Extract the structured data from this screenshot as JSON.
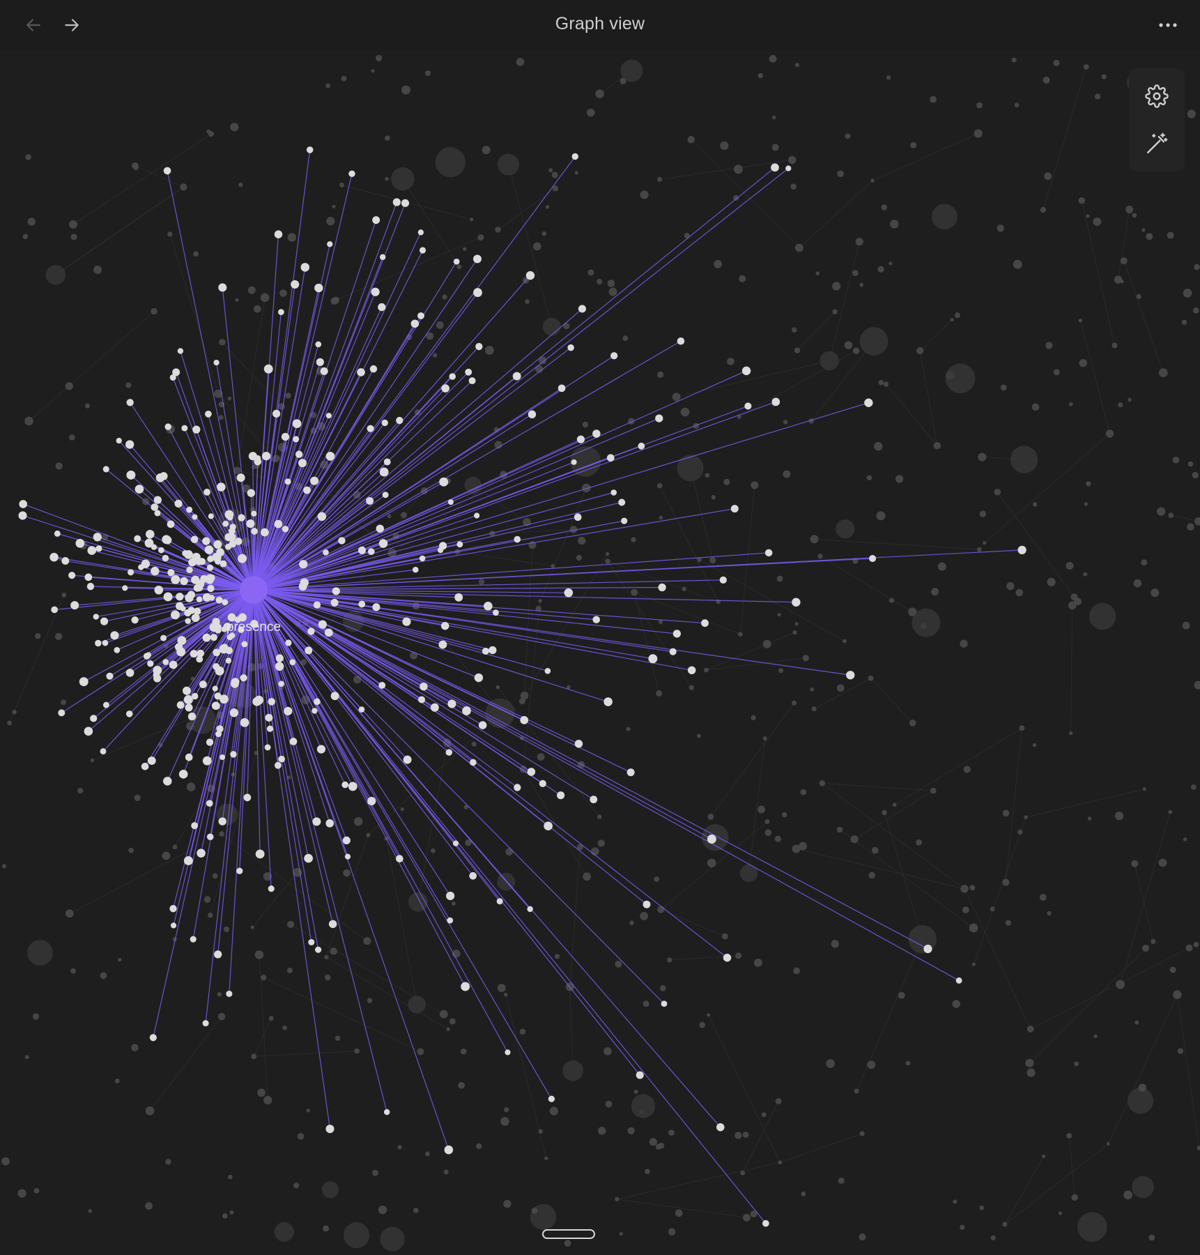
{
  "header": {
    "title": "Graph view"
  },
  "graph": {
    "focused_node": {
      "label": "presence"
    },
    "colors": {
      "background": "#1e1e1e",
      "accent": "#7b5cf0",
      "node": "#dcdcdc",
      "dim_node": "#4a4a4a",
      "dim_link": "#3a3a3a"
    }
  },
  "icons": {
    "back": "arrow-left-icon",
    "forward": "arrow-right-icon",
    "more": "more-horizontal-icon",
    "settings": "gear-icon",
    "magic": "magic-wand-icon"
  }
}
